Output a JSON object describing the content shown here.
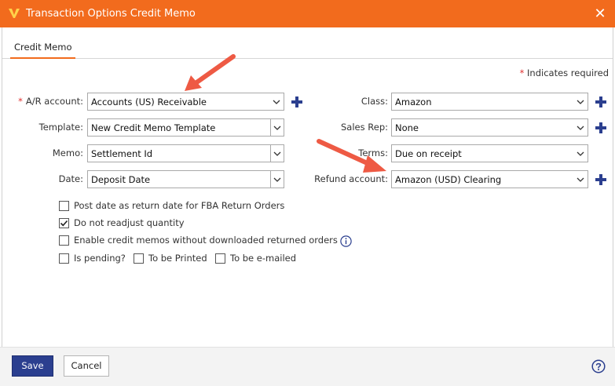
{
  "window": {
    "title": "Transaction Options Credit Memo",
    "close_glyph": "✕"
  },
  "tabs": [
    {
      "label": "Credit Memo",
      "active": true
    }
  ],
  "required_note": {
    "star": "*",
    "text": "Indicates required"
  },
  "form": {
    "ar_account": {
      "label": "A/R account:",
      "required": true,
      "value": "Accounts (US) Receivable"
    },
    "template": {
      "label": "Template:",
      "value": "New Credit Memo Template"
    },
    "memo": {
      "label": "Memo:",
      "value": "Settlement Id"
    },
    "date": {
      "label": "Date:",
      "value": "Deposit Date"
    },
    "class": {
      "label": "Class:",
      "value": "Amazon"
    },
    "sales_rep": {
      "label": "Sales Rep:",
      "value": "None"
    },
    "terms": {
      "label": "Terms:",
      "value": "Due on receipt"
    },
    "refund_account": {
      "label": "Refund account:",
      "value": "Amazon (USD) Clearing"
    }
  },
  "options": {
    "post_date": {
      "label": "Post date as return date for FBA Return Orders",
      "checked": false
    },
    "no_readjust": {
      "label": "Do not readjust quantity",
      "checked": true
    },
    "enable_credit": {
      "label": "Enable credit memos without downloaded returned orders",
      "checked": false
    },
    "is_pending": {
      "label": "Is pending?",
      "checked": false
    },
    "to_be_printed": {
      "label": "To be Printed",
      "checked": false
    },
    "to_be_emailed": {
      "label": "To be e-mailed",
      "checked": false
    }
  },
  "footer": {
    "save_label": "Save",
    "cancel_label": "Cancel"
  },
  "icons": {
    "app_logo": "logo-icon",
    "close": "close-icon",
    "dropdown": "chevron-down-icon",
    "add": "plus-icon",
    "info": "info-icon",
    "help": "help-icon",
    "annotation": "arrow-annotation"
  },
  "colors": {
    "titlebar": "#f26b1d",
    "accent_blue": "#2b3f8f",
    "required": "#e0302f",
    "annotation_arrow": "#ee5a44"
  }
}
